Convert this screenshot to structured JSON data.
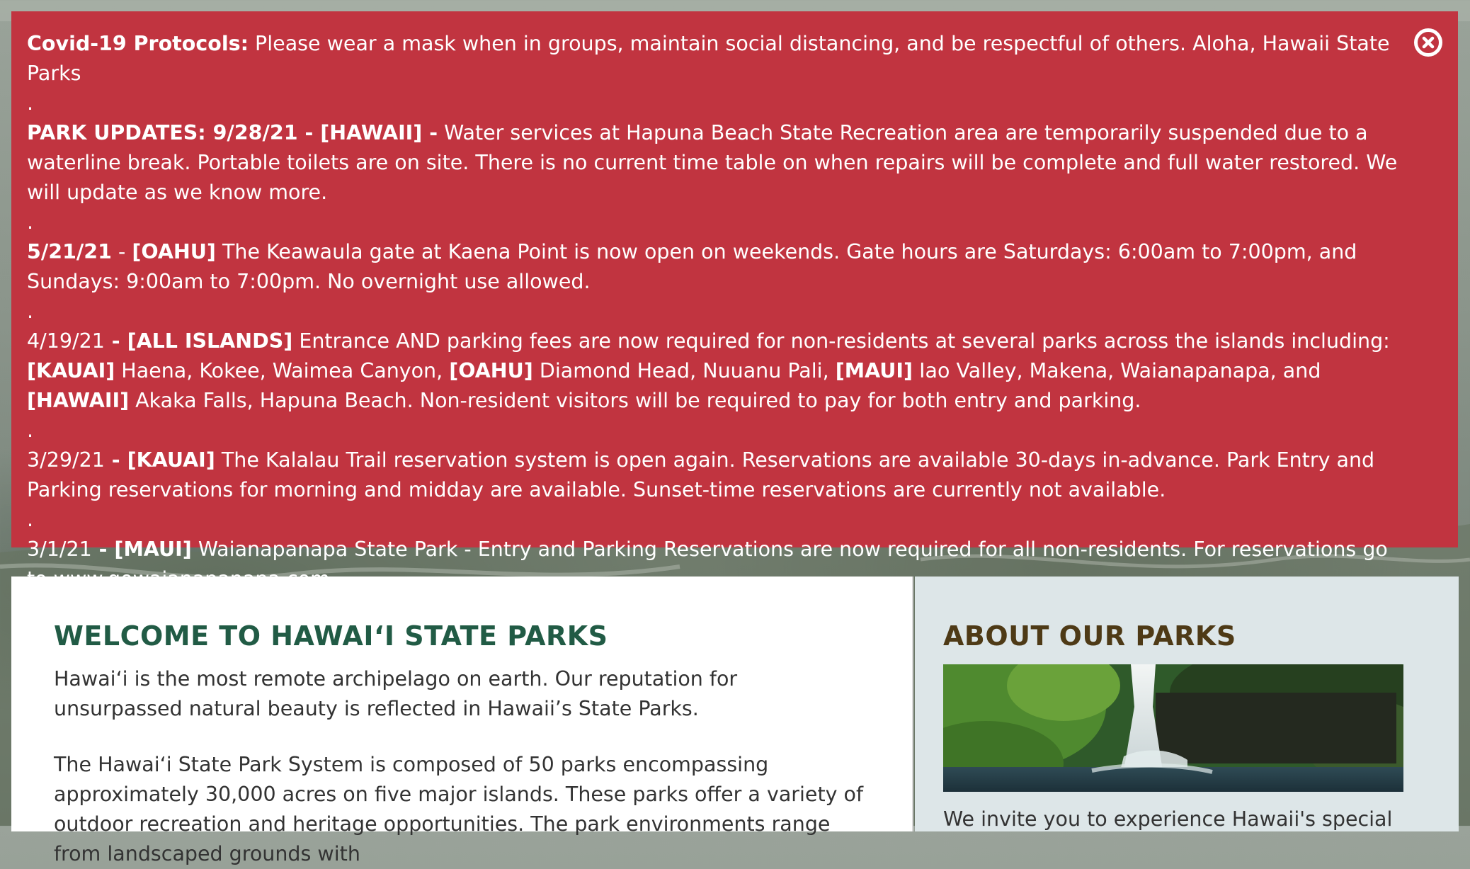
{
  "alert": {
    "covid_label": "Covid-19 Protocols:",
    "covid_text": " Please wear a mask when in groups, maintain social distancing, and be respectful of others. Aloha, Hawaii State Parks",
    "sep": ".",
    "update1_label": "PARK UPDATES:  9/28/21 - [HAWAII] -",
    "update1_text": " Water services at Hapuna Beach State Recreation area are temporarily suspended due to a waterline break. Portable toilets are on site. There is no current time table on when repairs will be complete and full water restored. We will update as we know more.",
    "update2_date": "5/21/21",
    "update2_dash": " - ",
    "update2_island": "[OAHU]",
    "update2_text": "  The Keawaula gate at Kaena Point is now open on weekends. Gate hours are Saturdays: 6:00am to 7:00pm, and Sundays: 9:00am to 7:00pm. No overnight use allowed.",
    "update3_date": "4/19/21",
    "update3_prefix": " - ",
    "update3_island": "[ALL ISLANDS]",
    "update3_text_a": " Entrance AND parking fees are now required for non-residents at several parks across the islands including: ",
    "update3_kauai": "[KAUAI]",
    "update3_text_b": " Haena, Kokee, Waimea Canyon, ",
    "update3_oahu": "[OAHU]",
    "update3_text_c": " Diamond Head, Nuuanu Pali, ",
    "update3_maui": "[MAUI]",
    "update3_text_d": " Iao Valley, Makena, Waianapanapa, and ",
    "update3_hawaii": "[HAWAII]",
    "update3_text_e": " Akaka Falls, Hapuna Beach.  Non-resident visitors will be required to pay for both entry and parking.",
    "update4_date": "3/29/21",
    "update4_prefix": " - ",
    "update4_island": "[KAUAI]",
    "update4_text": " The Kalalau Trail reservation system is open again. Reservations are available 30-days in-advance. Park Entry and Parking reservations for morning and midday are available. Sunset-time reservations are currently not available.",
    "update5_date": "3/1/21",
    "update5_prefix": " - ",
    "update5_island": "[MAUI]",
    "update5_text": " Waianapanapa State Park - Entry and Parking Reservations are now required for all non-residents. For reservations go to ",
    "update5_link": "www.gowaianapanapa.com",
    "close_icon": "close-circle-icon"
  },
  "welcome": {
    "title": "WELCOME TO HAWAIʻI STATE PARKS",
    "para1": "Hawaiʻi is the most remote archipelago on earth.  Our reputation for unsurpassed natural beauty is reflected in Hawaii’s State Parks.",
    "para2": "The Hawaiʻi State Park System is composed of 50 parks encompassing approximately 30,000 acres on five major islands. These parks offer a variety of outdoor recreation and heritage opportunities. The park environments range from landscaped grounds with"
  },
  "about": {
    "title": "ABOUT OUR PARKS",
    "text": "We invite you to experience Hawaii's special"
  },
  "colors": {
    "alert_bg": "#c13440",
    "welcome_title": "#215b45",
    "about_title": "#4e3a16",
    "about_bg": "#dde6e8"
  }
}
